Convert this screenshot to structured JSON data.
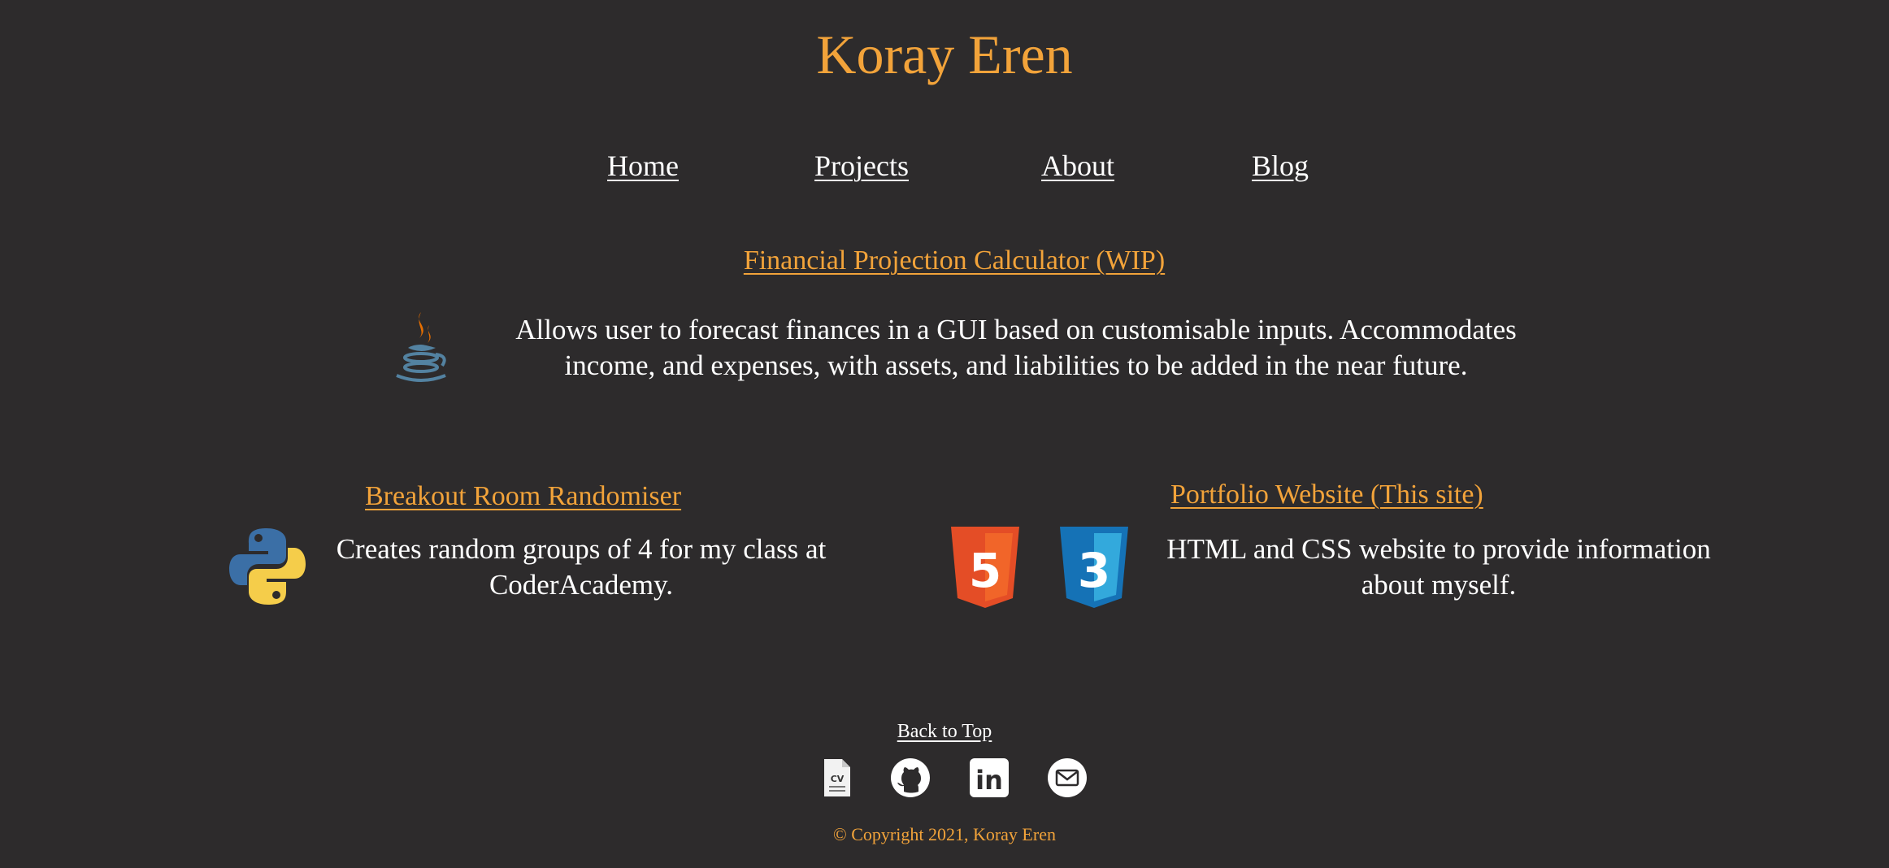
{
  "site": {
    "title": "Koray Eren"
  },
  "nav": {
    "items": [
      {
        "label": "Home"
      },
      {
        "label": "Projects"
      },
      {
        "label": "About"
      },
      {
        "label": "Blog"
      }
    ]
  },
  "projects": [
    {
      "title": "Financial Projection Calculator (WIP)",
      "description": "Allows user to forecast finances in a GUI based on customisable inputs. Accommodates income, and expenses, with assets, and liabilities to be added in the near future.",
      "icons": [
        "java-icon"
      ]
    },
    {
      "title": "Breakout Room Randomiser",
      "description": "Creates random groups of 4 for my class at CoderAcademy.",
      "icons": [
        "python-icon"
      ]
    },
    {
      "title": "Portfolio Website (This site)",
      "description": "HTML and CSS website to provide information about myself.",
      "icons": [
        "html5-icon",
        "css3-icon"
      ],
      "html5_glyph": "5",
      "css3_glyph": "3"
    }
  ],
  "footer": {
    "back_to_top": "Back to Top",
    "social_icons": [
      "cv-icon",
      "github-icon",
      "linkedin-icon",
      "email-icon"
    ],
    "cv_glyph": "CV",
    "linkedin_glyph": "in",
    "copyright": "© Copyright 2021, Koray Eren"
  },
  "colors": {
    "background": "#2d2b2c",
    "accent": "#f2a33a",
    "text": "#ffffff"
  }
}
